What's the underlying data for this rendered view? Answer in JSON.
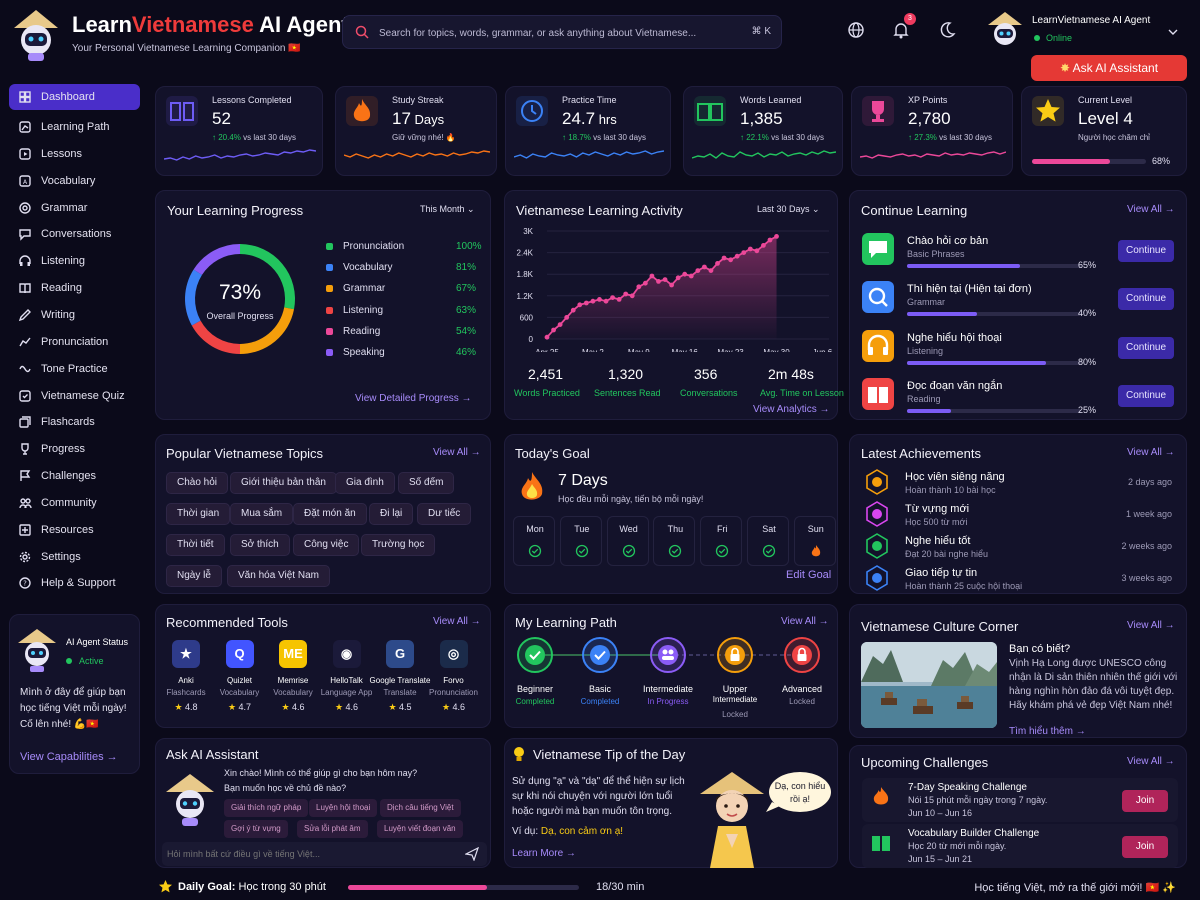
{
  "header": {
    "brand_a": "Learn",
    "brand_b": "Vietnamese",
    "brand_c": " AI Agent",
    "tagline": "Your Personal Vietnamese Learning Companion 🇻🇳",
    "search_placeholder": "Search for topics, words, grammar, or ask anything about Vietnamese...",
    "search_shortcut": "⌘ K",
    "notification_count": "3",
    "user_name": "LearnVietnamese AI Agent",
    "user_status": "Online",
    "ask_button": "Ask AI Assistant",
    "icons": [
      "globe-icon",
      "bell-icon",
      "moon-icon",
      "chevron-down-icon"
    ]
  },
  "sidebar": {
    "items": [
      {
        "label": "Dashboard",
        "icon": "grid-icon",
        "active": true
      },
      {
        "label": "Learning Path",
        "icon": "path-icon"
      },
      {
        "label": "Lessons",
        "icon": "play-icon"
      },
      {
        "label": "Vocabulary",
        "icon": "vocabulary-icon"
      },
      {
        "label": "Grammar",
        "icon": "grammar-icon"
      },
      {
        "label": "Conversations",
        "icon": "chat-icon"
      },
      {
        "label": "Listening",
        "icon": "headphones-icon"
      },
      {
        "label": "Reading",
        "icon": "book-icon"
      },
      {
        "label": "Writing",
        "icon": "pencil-icon"
      },
      {
        "label": "Pronunciation",
        "icon": "waveform-icon"
      },
      {
        "label": "Tone Practice",
        "icon": "tone-icon"
      },
      {
        "label": "Vietnamese Quiz",
        "icon": "quiz-icon"
      },
      {
        "label": "Flashcards",
        "icon": "cards-icon"
      },
      {
        "label": "Progress",
        "icon": "trophy-icon"
      },
      {
        "label": "Challenges",
        "icon": "flag-icon"
      },
      {
        "label": "Community",
        "icon": "community-icon"
      },
      {
        "label": "Resources",
        "icon": "resources-icon"
      },
      {
        "label": "Settings",
        "icon": "gear-icon"
      },
      {
        "label": "Help & Support",
        "icon": "help-icon"
      }
    ],
    "agent": {
      "title": "AI Agent Status",
      "status": "Active",
      "message": "Mình ở đây để giúp bạn học tiếng Việt mỗi ngày! Cố lên nhé! 💪🇻🇳",
      "link": "View Capabilities →"
    }
  },
  "stats": [
    {
      "label": "Lessons Completed",
      "value": "52",
      "unit": "",
      "change": "↑ 20.4%",
      "suffix": " vs last 30 days",
      "color": "#6d5cf5"
    },
    {
      "label": "Study Streak",
      "value": "17",
      "unit": " Days",
      "change": "",
      "suffix": "Giữ vững nhé! 🔥",
      "color": "#f97316"
    },
    {
      "label": "Practice Time",
      "value": "24.7",
      "unit": " hrs",
      "change": "↑ 18.7%",
      "suffix": " vs last 30 days",
      "color": "#3b82f6"
    },
    {
      "label": "Words Learned",
      "value": "1,385",
      "unit": "",
      "change": "↑ 22.1%",
      "suffix": " vs last 30 days",
      "color": "#22c55e"
    },
    {
      "label": "XP Points",
      "value": "2,780",
      "unit": "",
      "change": "↑ 27.3%",
      "suffix": " vs last 30 days",
      "color": "#ec4899"
    },
    {
      "label": "Current Level",
      "value": "Level 4",
      "unit": "",
      "change": "",
      "suffix": "Người học chăm chỉ",
      "color": "#facc15",
      "progress_text": "68%",
      "progress": 0.68
    }
  ],
  "progress": {
    "title": "Your Learning Progress",
    "period": "This Month",
    "overall_value": "73%",
    "overall_label": "Overall Progress",
    "skills": [
      {
        "name": "Pronunciation",
        "value": "100%",
        "color": "#22c55e"
      },
      {
        "name": "Vocabulary",
        "value": "81%",
        "color": "#3b82f6"
      },
      {
        "name": "Grammar",
        "value": "67%",
        "color": "#f59e0b"
      },
      {
        "name": "Listening",
        "value": "63%",
        "color": "#ef4444"
      },
      {
        "name": "Reading",
        "value": "54%",
        "color": "#ec4899"
      },
      {
        "name": "Speaking",
        "value": "46%",
        "color": "#8b5cf6"
      }
    ],
    "link": "View Detailed Progress →"
  },
  "activity": {
    "title": "Vietnamese Learning Activity",
    "period": "Last 30 Days",
    "summary": [
      {
        "value": "2,451",
        "label": "Words Practiced"
      },
      {
        "value": "1,320",
        "label": "Sentences Read"
      },
      {
        "value": "356",
        "label": "Conversations"
      },
      {
        "value": "2m 48s",
        "label": "Avg. Time on Lesson"
      }
    ],
    "link": "View Analytics →"
  },
  "chart_data": {
    "type": "area",
    "title": "Vietnamese Learning Activity",
    "x": [
      "Apr 25",
      "Apr 26",
      "Apr 27",
      "Apr 28",
      "Apr 29",
      "Apr 30",
      "May 1",
      "May 2",
      "May 3",
      "May 4",
      "May 5",
      "May 6",
      "May 7",
      "May 8",
      "May 9",
      "May 10",
      "May 11",
      "May 12",
      "May 13",
      "May 14",
      "May 15",
      "May 16",
      "May 17",
      "May 18",
      "May 19",
      "May 20",
      "May 21",
      "May 22",
      "May 23",
      "May 24",
      "May 25",
      "May 26",
      "May 27",
      "May 28",
      "May 29",
      "May 30",
      "May 31",
      "Jun 1",
      "Jun 2",
      "Jun 3",
      "Jun 4",
      "Jun 5",
      "Jun 6",
      "Jun 7"
    ],
    "x_ticks": [
      "Apr 25",
      "May 2",
      "May 9",
      "May 16",
      "May 23",
      "May 30",
      "Jun 6"
    ],
    "points": [
      [
        0,
        50
      ],
      [
        1,
        250
      ],
      [
        2,
        400
      ],
      [
        3,
        600
      ],
      [
        4,
        800
      ],
      [
        5,
        950
      ],
      [
        6,
        1000
      ],
      [
        7,
        1050
      ],
      [
        8,
        1100
      ],
      [
        9,
        1050
      ],
      [
        10,
        1150
      ],
      [
        11,
        1100
      ],
      [
        12,
        1250
      ],
      [
        13,
        1200
      ],
      [
        14,
        1450
      ],
      [
        15,
        1550
      ],
      [
        16,
        1750
      ],
      [
        17,
        1600
      ],
      [
        18,
        1650
      ],
      [
        19,
        1500
      ],
      [
        20,
        1700
      ],
      [
        21,
        1800
      ],
      [
        22,
        1750
      ],
      [
        23,
        1900
      ],
      [
        24,
        2000
      ],
      [
        25,
        1900
      ],
      [
        26,
        2100
      ],
      [
        27,
        2250
      ],
      [
        28,
        2200
      ],
      [
        29,
        2300
      ],
      [
        30,
        2400
      ],
      [
        31,
        2500
      ],
      [
        32,
        2450
      ],
      [
        33,
        2600
      ],
      [
        34,
        2750
      ],
      [
        35,
        2850
      ]
    ],
    "ylim": [
      0,
      3000
    ],
    "y_ticks": [
      "0",
      "600",
      "1.2K",
      "1.8K",
      "2.4K",
      "3K"
    ],
    "color": "#ec4899",
    "grid": true
  },
  "continue": {
    "title": "Continue Learning",
    "link": "View All →",
    "items": [
      {
        "title": "Chào hỏi cơ bản",
        "subtitle": "Basic Phrases",
        "percent": "65%",
        "progress": 0.65,
        "button": "Continue",
        "icon": "chat-bubble-icon",
        "color": "#22c55e"
      },
      {
        "title": "Thì hiện tại (Hiện tại đơn)",
        "subtitle": "Grammar",
        "percent": "40%",
        "progress": 0.4,
        "button": "Continue",
        "icon": "magnify-icon",
        "color": "#3b82f6"
      },
      {
        "title": "Nghe hiểu hội thoại",
        "subtitle": "Listening",
        "percent": "80%",
        "progress": 0.8,
        "button": "Continue",
        "icon": "headphones-icon",
        "color": "#f59e0b"
      },
      {
        "title": "Đọc đoạn văn ngắn",
        "subtitle": "Reading",
        "percent": "25%",
        "progress": 0.25,
        "button": "Continue",
        "icon": "book-icon",
        "color": "#ef4444"
      }
    ]
  },
  "topics": {
    "title": "Popular Vietnamese Topics",
    "link": "View All →",
    "chips": [
      "Chào hỏi",
      "Giới thiệu bản thân",
      "Gia đình",
      "Số đếm",
      "Thời gian",
      "Mua sắm",
      "Đặt món ăn",
      "Đi lại",
      "Dư tiếc",
      "Thời tiết",
      "Sở thích",
      "Công việc",
      "Trường học",
      "Ngày lễ",
      "Văn hóa Việt Nam"
    ]
  },
  "goal": {
    "title": "Today's Goal",
    "days_text": "7 Days",
    "subtitle": "Học đều mỗi ngày, tiến bộ mỗi ngày!",
    "days": [
      "Mon",
      "Tue",
      "Wed",
      "Thu",
      "Fri",
      "Sat",
      "Sun"
    ],
    "link": "Edit Goal"
  },
  "achievements": {
    "title": "Latest Achievements",
    "link": "View All →",
    "items": [
      {
        "title": "Học viên siêng năng",
        "subtitle": "Hoàn thành 10 bài học",
        "date": "2 days ago",
        "color": "#f59e0b"
      },
      {
        "title": "Từ vựng mới",
        "subtitle": "Học 500 từ mới",
        "date": "1 week ago",
        "color": "#d946ef"
      },
      {
        "title": "Nghe hiểu tốt",
        "subtitle": "Đạt 20 bài nghe hiểu",
        "date": "2 weeks ago",
        "color": "#22c55e"
      },
      {
        "title": "Giao tiếp tự tin",
        "subtitle": "Hoàn thành 25 cuộc hội thoại",
        "date": "3 weeks ago",
        "color": "#3b82f6"
      }
    ]
  },
  "tools": {
    "title": "Recommended Tools",
    "link": "View All →",
    "items": [
      {
        "name": "Anki",
        "category": "Flashcards",
        "rating": "4.8",
        "color": "#2e3b8a"
      },
      {
        "name": "Quizlet",
        "category": "Vocabulary",
        "rating": "4.7",
        "color": "#4255ff"
      },
      {
        "name": "Memrise",
        "category": "Vocabulary",
        "rating": "4.6",
        "color": "#f6c400"
      },
      {
        "name": "HelloTalk",
        "category": "Language App",
        "rating": "4.6",
        "color": "#1b1a3a"
      },
      {
        "name": "Google Translate",
        "category": "Translate",
        "rating": "4.5",
        "color": "#2d4a8a"
      },
      {
        "name": "Forvo",
        "category": "Pronunciation",
        "rating": "4.6",
        "color": "#1b2b4a"
      }
    ]
  },
  "path": {
    "title": "My Learning Path",
    "link": "View All →",
    "steps": [
      {
        "name": "Beginner",
        "status": "Completed",
        "color": "#22c55e",
        "status_color": "#22c55e"
      },
      {
        "name": "Basic",
        "status": "Completed",
        "color": "#3b82f6",
        "status_color": "#3b82f6"
      },
      {
        "name": "Intermediate",
        "status": "In Progress",
        "color": "#8b5cf6",
        "status_color": "#8b5cf6"
      },
      {
        "name": "Upper",
        "name2": "Intermediate",
        "status": "Locked",
        "color": "#f59e0b",
        "status_color": "#9d9ab6"
      },
      {
        "name": "Advanced",
        "status": "Locked",
        "color": "#ef4444",
        "status_color": "#9d9ab6"
      }
    ]
  },
  "culture": {
    "title": "Vietnamese Culture Corner",
    "link": "View All →",
    "heading": "Bạn có biết?",
    "text": "Vịnh Hạ Long được UNESCO công nhận là Di sản thiên nhiên thế giới với hàng nghìn hòn đảo đá vôi tuyệt đẹp. Hãy khám phá vẻ đẹp Việt Nam nhé!",
    "more": "Tìm hiểu thêm →"
  },
  "ask": {
    "title": "Ask AI Assistant",
    "greeting": "Xin chào! Mình có thể giúp gì cho bạn hôm nay?",
    "question": "Bạn muốn học về chủ đề nào?",
    "suggestions": [
      "Giải thích ngữ pháp",
      "Luyện hội thoại",
      "Dịch câu tiếng Việt",
      "Gợi ý từ vựng",
      "Sửa lỗi phát âm",
      "Luyện viết đoạn văn"
    ],
    "input_placeholder": "Hỏi mình bất cứ điều gì về tiếng Việt..."
  },
  "tip": {
    "title": "Vietnamese Tip of the Day",
    "text": "Sử dụng \"ạ\" và \"dạ\" để thể hiện sự lịch sự khi nói chuyện với người lớn tuổi hoặc người mà bạn muốn tôn trọng.",
    "example_label": "Ví dụ: ",
    "example": "Dạ, con cảm ơn ạ!",
    "bubble": "Dạ, con hiểu rồi ạ!",
    "link": "Learn More →"
  },
  "challenges": {
    "title": "Upcoming Challenges",
    "link": "View All →",
    "items": [
      {
        "title": "7-Day Speaking Challenge",
        "desc": "Nói 15 phút mỗi ngày trong 7 ngày.",
        "dates": "Jun 10 – Jun 16",
        "button": "Join"
      },
      {
        "title": "Vocabulary Builder Challenge",
        "desc": "Học 20 từ mới mỗi ngày.",
        "dates": "Jun 15 – Jun 21",
        "button": "Join"
      }
    ]
  },
  "daily": {
    "label": "Daily Goal:",
    "text": " Học trong 30 phút",
    "progress_text": "18/30 min",
    "progress": 0.6,
    "footer": "Học tiếng Việt, mở ra thế giới mới! 🇻🇳 ✨"
  }
}
